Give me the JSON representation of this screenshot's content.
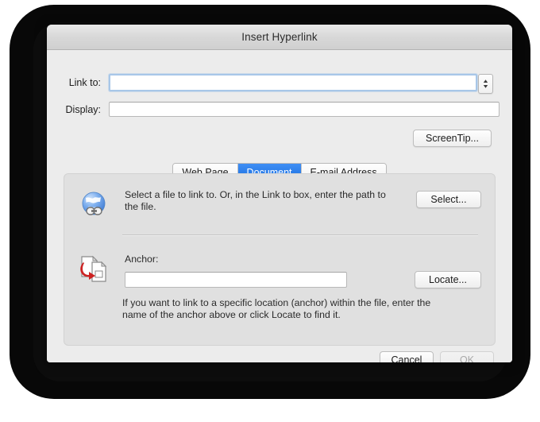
{
  "window": {
    "title": "Insert Hyperlink"
  },
  "fields": {
    "link_to": {
      "label": "Link to:",
      "value": "",
      "placeholder": ""
    },
    "display": {
      "label": "Display:",
      "value": "",
      "placeholder": ""
    },
    "stepper_icon": "up-down-stepper-icon"
  },
  "toolbar": {
    "screentip_label": "ScreenTip..."
  },
  "tabs": [
    {
      "label": "Web Page",
      "active": false
    },
    {
      "label": "Document",
      "active": true
    },
    {
      "label": "E-mail Address",
      "active": false
    }
  ],
  "panel": {
    "file_section": {
      "icon": "globe-link-icon",
      "description": "Select a file to link to. Or, in the Link to box, enter the path to the file.",
      "button_label": "Select..."
    },
    "anchor_section": {
      "icon": "anchor-document-icon",
      "label": "Anchor:",
      "value": "",
      "placeholder": "",
      "button_label": "Locate...",
      "help_text": "If you want to link to a specific location (anchor) within the file, enter the name of the anchor above or click Locate to find it."
    }
  },
  "footer": {
    "cancel_label": "Cancel",
    "ok_label": "OK",
    "ok_enabled": false
  },
  "colors": {
    "accent": "#1a6fe0",
    "focus_ring": "#a8c7e8",
    "panel_bg": "#e0e0e0",
    "dialog_bg": "#ececec",
    "frame": "#080808"
  }
}
